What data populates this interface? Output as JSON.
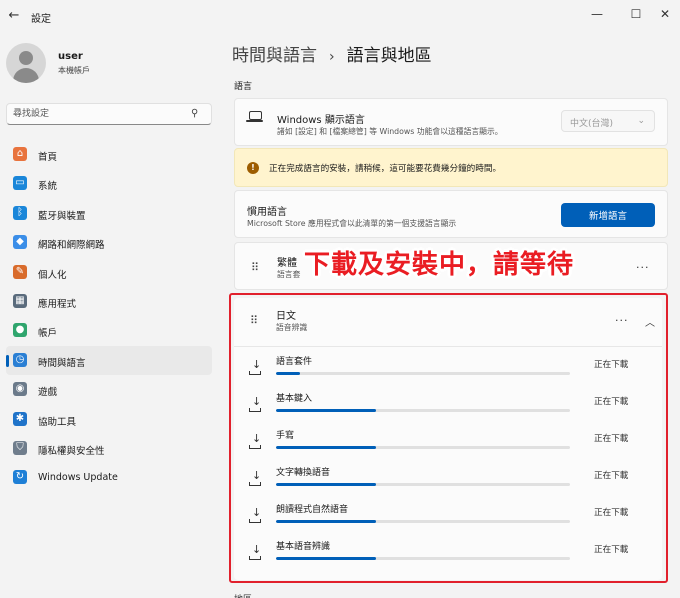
{
  "window": {
    "title": "設定",
    "back_icon": "arrow-left-icon",
    "controls": [
      "minimize-icon",
      "maximize-icon",
      "close-icon"
    ]
  },
  "user": {
    "name": "user",
    "account_type": "本機帳戶"
  },
  "search": {
    "placeholder": "尋找設定"
  },
  "sidebar": {
    "items": [
      {
        "label": "首頁",
        "icon": "home-icon",
        "color": "#e8733d"
      },
      {
        "label": "系統",
        "icon": "monitor-icon",
        "color": "#1a86d9"
      },
      {
        "label": "藍牙與裝置",
        "icon": "bluetooth-icon",
        "color": "#1a86d9"
      },
      {
        "label": "網路和網際網路",
        "icon": "wifi-icon",
        "color": "#3b8ee8"
      },
      {
        "label": "個人化",
        "icon": "brush-icon",
        "color": "#d96b2b"
      },
      {
        "label": "應用程式",
        "icon": "apps-icon",
        "color": "#5a6b7c"
      },
      {
        "label": "帳戶",
        "icon": "person-icon",
        "color": "#2fa56d"
      },
      {
        "label": "時間與語言",
        "icon": "globe-clock-icon",
        "color": "#2a7fd4",
        "active": true
      },
      {
        "label": "遊戲",
        "icon": "gamepad-icon",
        "color": "#6b7a8a"
      },
      {
        "label": "協助工具",
        "icon": "accessibility-icon",
        "color": "#1f73c9"
      },
      {
        "label": "隱私權與安全性",
        "icon": "shield-icon",
        "color": "#6f7d8c"
      },
      {
        "label": "Windows Update",
        "icon": "update-icon",
        "color": "#1e7fd6"
      }
    ]
  },
  "breadcrumb": {
    "parent": "時間與語言",
    "separator": "›",
    "current": "語言與地區"
  },
  "section": {
    "language": "語言",
    "next": "地區"
  },
  "display_language": {
    "title": "Windows 顯示語言",
    "description": "諸如 [設定] 和 [檔案總管] 等 Windows 功能會以這種語言顯示。",
    "value": "中文(台灣)"
  },
  "warning": {
    "text": "正在完成語言的安裝，請稍候，這可能要花費幾分鐘的時間。"
  },
  "preferred": {
    "title": "慣用語言",
    "description": "Microsoft Store 應用程式會以此清單的第一個支援語言顯示",
    "add_button": "新增語言"
  },
  "traditional_chinese": {
    "title": "繁體",
    "description": "語言套"
  },
  "callout": {
    "text": "下載及安裝中，請等待"
  },
  "japanese": {
    "title": "日文",
    "description": "語音辨識",
    "downloads": [
      {
        "label": "語言套件",
        "status": "正在下載",
        "progress": 0.08
      },
      {
        "label": "基本鍵入",
        "status": "正在下載",
        "progress": 0.34
      },
      {
        "label": "手寫",
        "status": "正在下載",
        "progress": 0.34
      },
      {
        "label": "文字轉換語音",
        "status": "正在下載",
        "progress": 0.34
      },
      {
        "label": "朗讀程式自然語音",
        "status": "正在下載",
        "progress": 0.34
      },
      {
        "label": "基本語音辨識",
        "status": "正在下載",
        "progress": 0.34
      }
    ]
  },
  "accent_color": "#005fb8",
  "callout_color": "#ea1d23"
}
